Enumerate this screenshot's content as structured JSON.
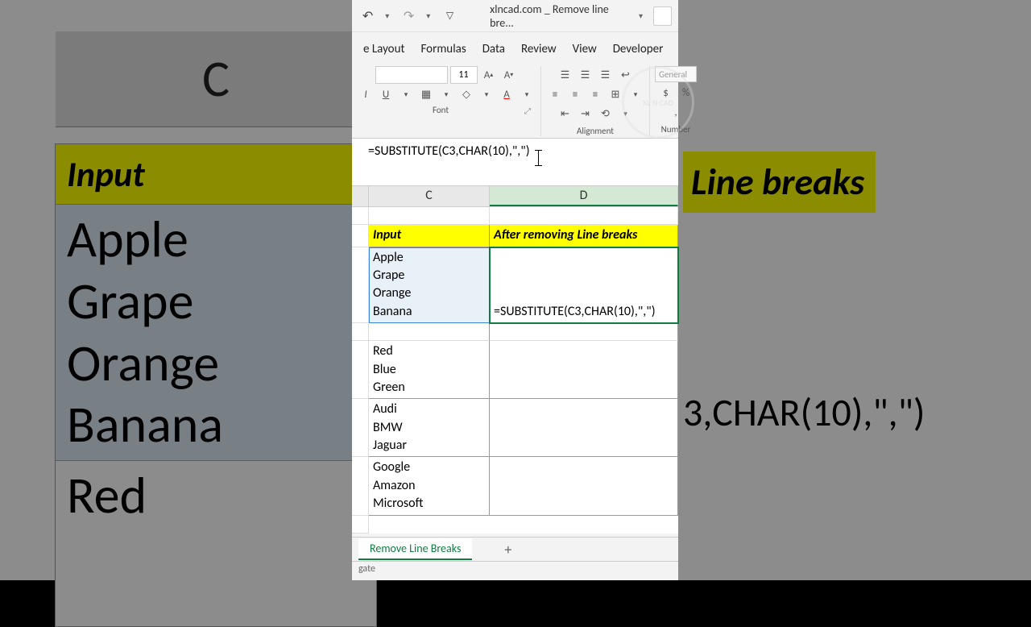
{
  "qat": {
    "doc_title": "xlncad.com _ Remove line bre..."
  },
  "ribbon": {
    "tabs": {
      "layout": "e Layout",
      "formulas": "Formulas",
      "data": "Data",
      "review": "Review",
      "view": "View",
      "developer": "Developer"
    },
    "font_size": "11",
    "groups": {
      "font": "Font",
      "alignment": "Alignment",
      "number": "Number"
    },
    "number_format": "General"
  },
  "formula_bar": "=SUBSTITUTE(C3,CHAR(10),\",\")",
  "columns": {
    "c": "C",
    "d": "D"
  },
  "headers": {
    "input": "Input",
    "output": "After removing Line breaks"
  },
  "rows": {
    "r3": {
      "c_lines": [
        "Apple",
        "Grape",
        "Orange",
        "Banana"
      ],
      "d": "=SUBSTITUTE(C3,CHAR(10),\",\")"
    },
    "r5": {
      "c_lines": [
        "Red",
        "Blue",
        "Green"
      ]
    },
    "r6": {
      "c_lines": [
        "Audi",
        "BMW",
        "Jaguar"
      ]
    },
    "r7": {
      "c_lines": [
        "Google",
        "Amazon",
        "Microsoft"
      ]
    }
  },
  "tabs": {
    "sheet1": "Remove Line Breaks"
  },
  "status": "gate",
  "bg": {
    "col_c_big": "C",
    "input_hdr": "Input",
    "line_breaks": "Line breaks",
    "c3_lines": [
      "Apple",
      "Grape",
      "Orange",
      "Banana"
    ],
    "red": "Red",
    "formula_frag": "3,CHAR(10),\",\")"
  }
}
